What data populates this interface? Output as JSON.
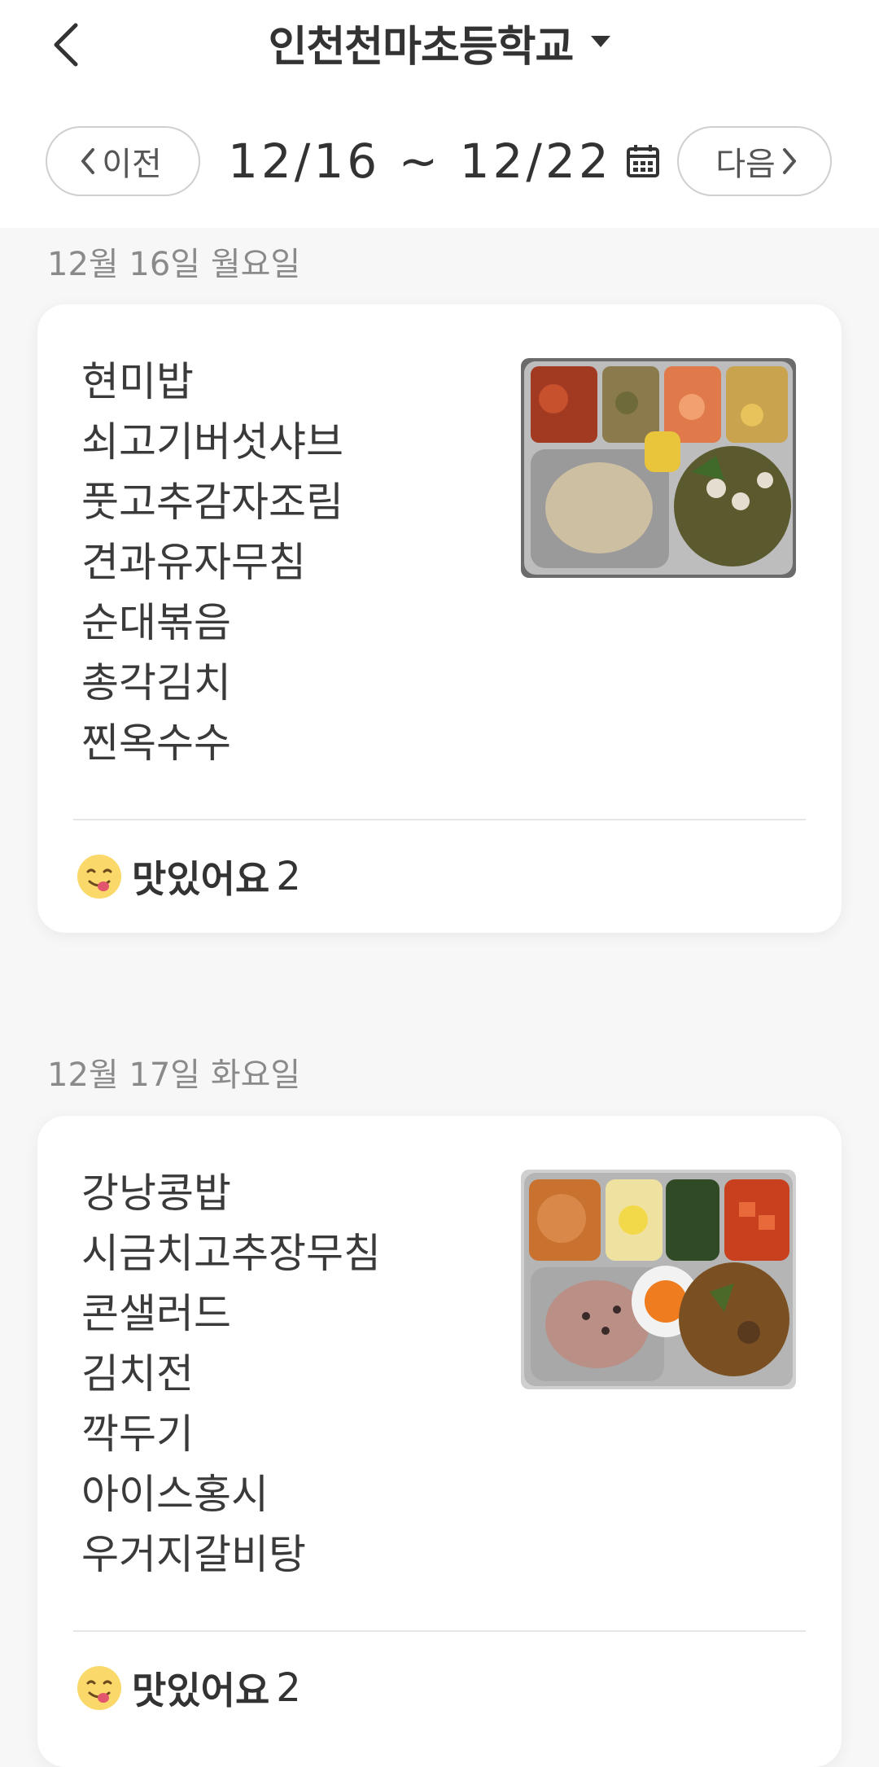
{
  "header": {
    "title": "인천천마초등학교"
  },
  "date_nav": {
    "prev_label": "이전",
    "range": "12/16 ~ 12/22",
    "next_label": "다음"
  },
  "days": [
    {
      "date_label": "12월 16일 월요일",
      "menu": [
        "현미밥",
        "쇠고기버섯샤브",
        "풋고추감자조림",
        "견과유자무침",
        "순대볶음",
        "총각김치",
        "찐옥수수"
      ],
      "reaction_label": "맛있어요",
      "reaction_count": "2"
    },
    {
      "date_label": "12월 17일 화요일",
      "menu": [
        "강낭콩밥",
        "시금치고추장무침",
        "콘샐러드",
        "김치전",
        "깍두기",
        "아이스홍시",
        "우거지갈비탕"
      ],
      "reaction_label": "맛있어요",
      "reaction_count": "2"
    }
  ]
}
